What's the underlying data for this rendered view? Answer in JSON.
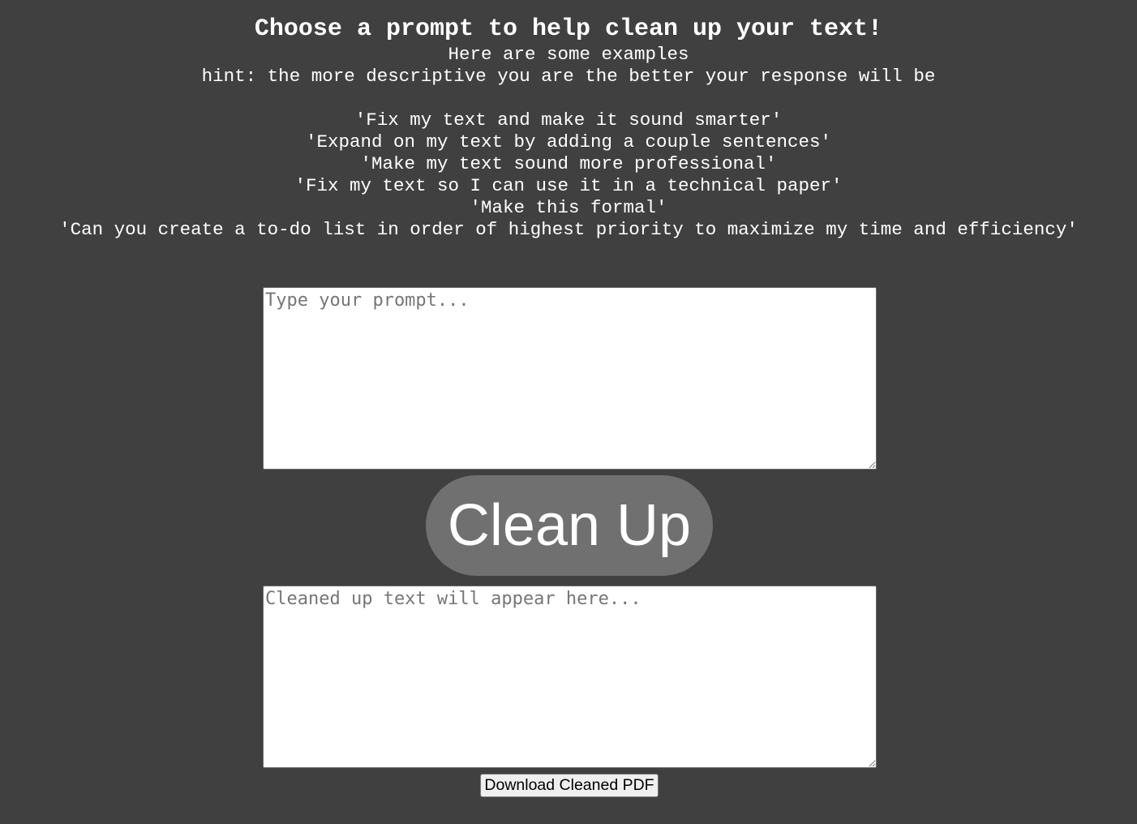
{
  "header": {
    "title": "Choose a prompt to help clean up your text!",
    "subtitle": "Here are some examples",
    "hint": "hint: the more descriptive you are the better your response will be",
    "examples": [
      "'Fix my text and make it sound smarter'",
      "'Expand on my text by adding a couple sentences'",
      "'Make my text sound more professional'",
      "'Fix my text so I can use it in a technical paper'",
      "'Make this formal'",
      "'Can you create a to-do list in order of highest priority to maximize my time and efficiency'"
    ]
  },
  "prompt_input": {
    "value": "",
    "placeholder": "Type your prompt..."
  },
  "clean_button": {
    "label": "Clean Up"
  },
  "output": {
    "value": "",
    "placeholder": "Cleaned up text will appear here..."
  },
  "download_button": {
    "label": "Download Cleaned PDF"
  },
  "colors": {
    "background": "#404040",
    "button": "#707070",
    "text": "#ffffff"
  }
}
